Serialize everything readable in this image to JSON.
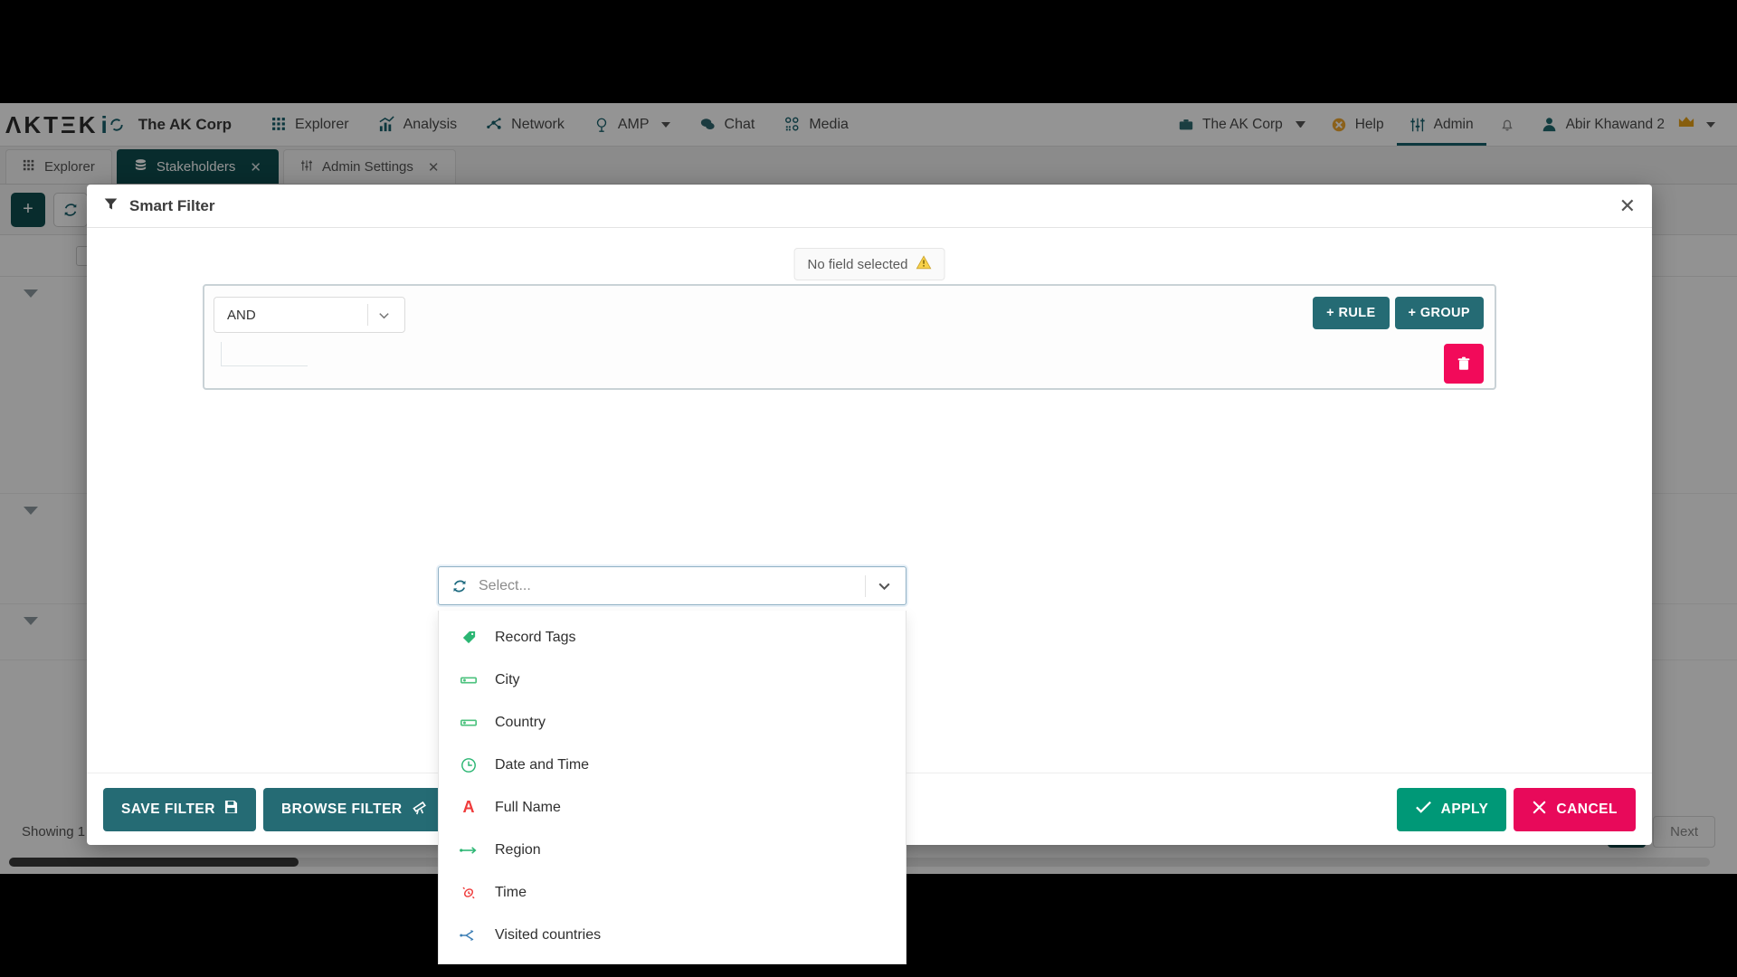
{
  "brand": {
    "wordmark": "ΛKTΞK",
    "suffix": "i",
    "org": "The AK Corp"
  },
  "topnav": {
    "items": [
      {
        "label": "Explorer",
        "icon": "grid-icon"
      },
      {
        "label": "Analysis",
        "icon": "bar-chart-icon"
      },
      {
        "label": "Network",
        "icon": "network-icon"
      },
      {
        "label": "AMP",
        "icon": "amp-icon",
        "has_caret": true
      },
      {
        "label": "Chat",
        "icon": "chat-icon"
      },
      {
        "label": "Media",
        "icon": "media-icon"
      }
    ],
    "right": {
      "org_switcher": "The AK Corp",
      "help": "Help",
      "admin": "Admin",
      "user": "Abir Khawand 2"
    }
  },
  "tabs": [
    {
      "label": "Explorer",
      "icon": "grid-icon",
      "active": false,
      "closable": false
    },
    {
      "label": "Stakeholders",
      "icon": "database-icon",
      "active": true,
      "closable": true
    },
    {
      "label": "Admin Settings",
      "icon": "sliders-icon",
      "active": false,
      "closable": true
    }
  ],
  "background": {
    "toolbar": {
      "add": "+",
      "refresh": "refresh-icon"
    },
    "status_text": "Showing 1",
    "next_label": "Next"
  },
  "modal": {
    "title": "Smart Filter",
    "close_label": "✕",
    "warning": {
      "text": "No field selected",
      "icon": "warning-triangle-icon"
    },
    "group": {
      "operator": "AND",
      "add_rule_label": "+ RULE",
      "add_group_label": "+ GROUP",
      "delete_icon": "trash-icon"
    },
    "field_select": {
      "placeholder": "Select...",
      "value": "",
      "refresh_icon": "refresh-icon",
      "chevron_icon": "chevron-down-icon"
    },
    "dropdown_options": [
      {
        "label": "Record Tags",
        "icon": "tag-icon",
        "color": "#2bb673"
      },
      {
        "label": "City",
        "icon": "link-range-icon",
        "color": "#4cc27e"
      },
      {
        "label": "Country",
        "icon": "link-range-icon",
        "color": "#4cc27e"
      },
      {
        "label": "Date and Time",
        "icon": "clock-icon",
        "color": "#2bb673"
      },
      {
        "label": "Full Name",
        "icon": "letter-a-icon",
        "color": "#ef3b3b"
      },
      {
        "label": "Region",
        "icon": "arrow-line-icon",
        "color": "#2bb673"
      },
      {
        "label": "Time",
        "icon": "watch-icon",
        "color": "#ef3b3b"
      },
      {
        "label": "Visited countries",
        "icon": "branch-icon",
        "color": "#3d7fb5"
      }
    ],
    "footer": {
      "save_filter": "SAVE FILTER",
      "browse_filter": "BROWSE FILTER",
      "apply": "APPLY",
      "cancel": "CANCEL"
    }
  },
  "colors": {
    "brand_teal": "#17606b",
    "tab_active": "#0f4c4f",
    "button_teal": "#256b74",
    "apply_green": "#009877",
    "cancel_pink": "#e8095a",
    "delete_pink": "#f20a5a"
  }
}
